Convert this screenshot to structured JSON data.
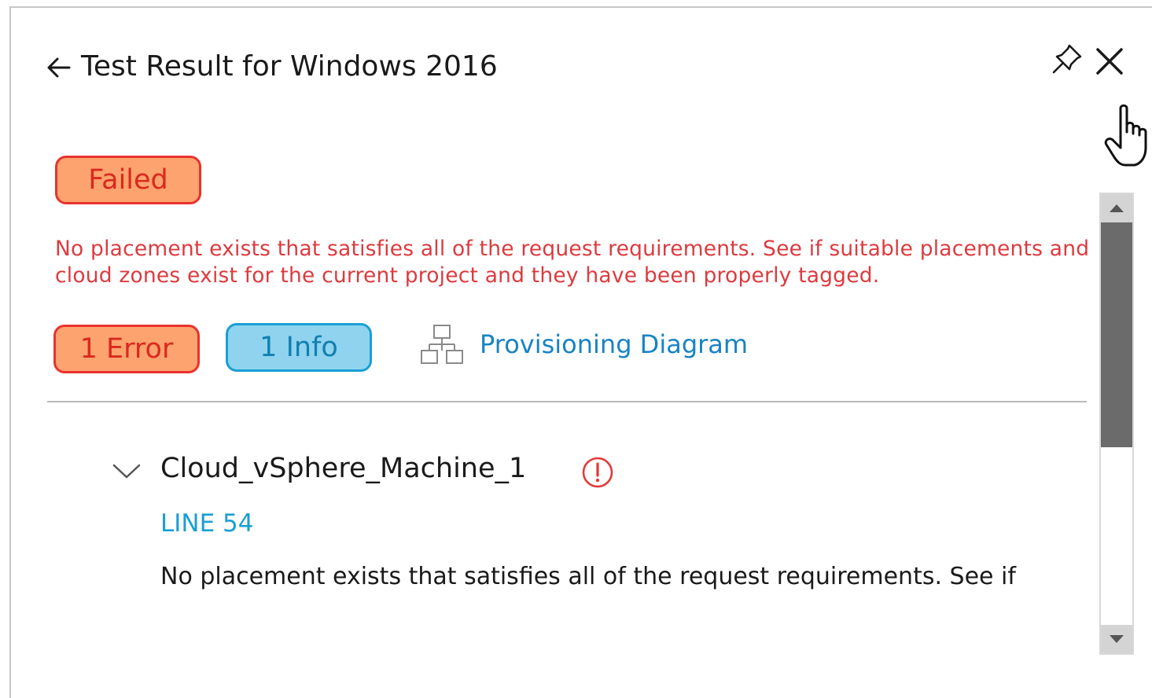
{
  "header": {
    "title": "Test Result for Windows 2016",
    "back_icon": "arrow-left-icon",
    "pin_icon": "pin-icon",
    "close_icon": "close-icon"
  },
  "status": {
    "label": "Failed",
    "message": "No placement exists that satisfies all of the request requirements. See if suitable placements and cloud zones exist for the current project and they have been properly tagged."
  },
  "filters": {
    "error_label": "1 Error",
    "info_label": "1 Info",
    "diagram_label": "Provisioning Diagram"
  },
  "results": [
    {
      "name": "Cloud_vSphere_Machine_1",
      "line": "LINE 54",
      "message": "No placement exists that satisfies all of the request requirements. See if"
    }
  ],
  "colors": {
    "error_fill": "#fca36f",
    "error_border": "#e8322e",
    "error_text": "#dc3b3f",
    "info_fill": "#8fd3ee",
    "info_border": "#1a9fd3",
    "link": "#1883c4"
  }
}
